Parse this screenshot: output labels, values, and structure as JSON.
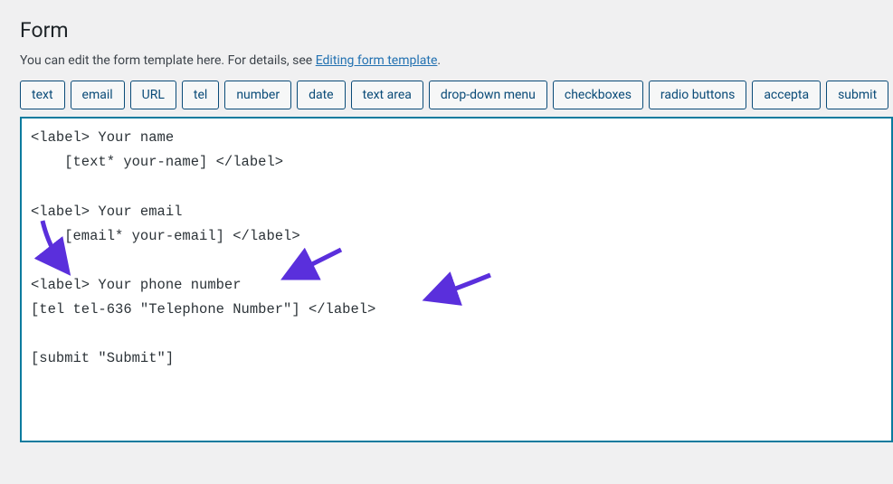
{
  "heading": "Form",
  "description_prefix": "You can edit the form template here. For details, see ",
  "description_link": "Editing form template",
  "description_suffix": ".",
  "tag_buttons": [
    "text",
    "email",
    "URL",
    "tel",
    "number",
    "date",
    "text area",
    "drop-down menu",
    "checkboxes",
    "radio buttons",
    "accepta",
    "submit"
  ],
  "code": "<label> Your name\n    [text* your-name] </label>\n\n<label> Your email\n    [email* your-email] </label>\n\n<label> Your phone number\n[tel tel-636 \"Telephone Number\"] </label>\n\n[submit \"Submit\"]",
  "annotation_color": "#5a2fdc"
}
